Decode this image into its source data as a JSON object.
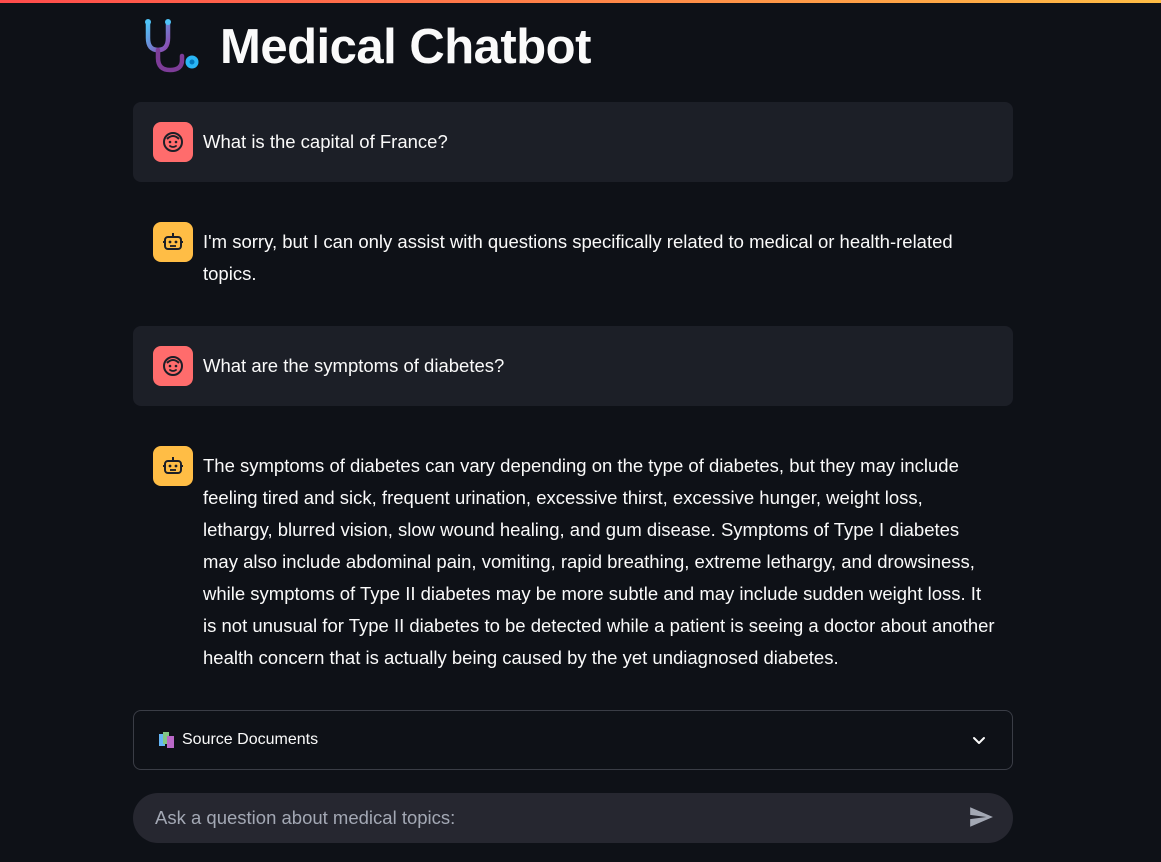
{
  "app": {
    "title": "Medical Chatbot",
    "title_icon": "stethoscope-icon"
  },
  "messages": [
    {
      "role": "user",
      "avatar_icon": "user-face-icon",
      "text": "What is the capital of France?"
    },
    {
      "role": "assistant",
      "avatar_icon": "robot-icon",
      "text": "I'm sorry, but I can only assist with questions specifically related to medical or health-related topics."
    },
    {
      "role": "user",
      "avatar_icon": "user-face-icon",
      "text": "What are the symptoms of diabetes?"
    },
    {
      "role": "assistant",
      "avatar_icon": "robot-icon",
      "text": "The symptoms of diabetes can vary depending on the type of diabetes, but they may include feeling tired and sick, frequent urination, excessive thirst, excessive hunger, weight loss, lethargy, blurred vision, slow wound healing, and gum disease. Symptoms of Type I diabetes may also include abdominal pain, vomiting, rapid breathing, extreme lethargy, and drowsiness, while symptoms of Type II diabetes may be more subtle and may include sudden weight loss. It is not unusual for Type II diabetes to be detected while a patient is seeing a doctor about another health concern that is actually being caused by the yet undiagnosed diabetes."
    }
  ],
  "expander": {
    "icon": "books-icon",
    "label": "Source Documents",
    "expanded": false
  },
  "chat_input": {
    "placeholder": "Ask a question about medical topics:",
    "value": "",
    "send_icon": "send-icon"
  },
  "colors": {
    "background": "#0e1117",
    "user_message_bg": "#1c1f27",
    "user_avatar": "#ff6c6c",
    "assistant_avatar": "#ffbd45",
    "input_bg": "#262730",
    "accent_gradient_start": "#ff4b4b",
    "accent_gradient_end": "#ffbd45"
  }
}
